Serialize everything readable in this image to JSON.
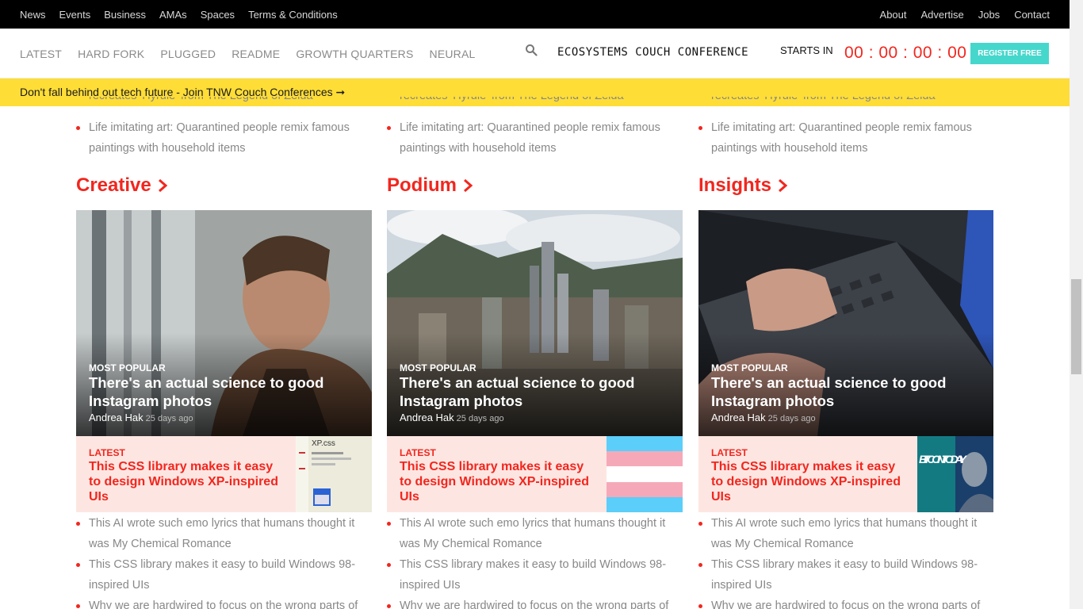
{
  "topnav": {
    "left": [
      "News",
      "Events",
      "Business",
      "AMAs",
      "Spaces",
      "Terms & Conditions"
    ],
    "right": [
      "About",
      "Advertise",
      "Jobs",
      "Contact"
    ]
  },
  "mainnav": {
    "categories": [
      "LATEST",
      "HARD FORK",
      "PLUGGED",
      "README",
      "GROWTH QUARTERS",
      "NEURAL"
    ],
    "conference": "ECOSYSTEMS COUCH CONFERENCE",
    "starts_in": "STARTS IN",
    "timer": "00 : 00 : 00 : 00",
    "register": "REGISTER FREE"
  },
  "banner": {
    "text": "Don't fall behind out tech future - Join TNW Couch Conferences ➞"
  },
  "columns": [
    {
      "top_cut": "recreates 'Hyrule' from The Legend of Zelda",
      "top_bullet": "Life imitating art: Quarantined people remix famous paintings with household items",
      "section": "Creative",
      "hero_kicker": "MOST POPULAR",
      "hero_title": "There's an actual science to good Instagram photos",
      "hero_author": "Andrea Hak",
      "hero_ago": "25 days ago",
      "latest_kicker": "LATEST",
      "latest_title": "This CSS library makes it easy to design Windows XP-inspired UIs",
      "bullets": [
        "This AI wrote such emo lyrics that humans thought it was My Chemical Romance",
        "This CSS library makes it easy to build Windows 98-inspired UIs",
        "Why we are hardwired to focus on the wrong parts of"
      ]
    },
    {
      "top_cut": "recreates 'Hyrule' from The Legend of Zelda",
      "top_bullet": "Life imitating art: Quarantined people remix famous paintings with household items",
      "section": "Podium",
      "hero_kicker": "MOST POPULAR",
      "hero_title": "There's an actual science to good Instagram photos",
      "hero_author": "Andrea Hak",
      "hero_ago": "25 days ago",
      "latest_kicker": "LATEST",
      "latest_title": "This CSS library makes it easy to design Windows XP-inspired UIs",
      "bullets": [
        "This AI wrote such emo lyrics that humans thought it was My Chemical Romance",
        "This CSS library makes it easy to build Windows 98-inspired UIs",
        "Why we are hardwired to focus on the wrong parts of"
      ]
    },
    {
      "top_cut": "recreates 'Hyrule' from The Legend of Zelda",
      "top_bullet": "Life imitating art: Quarantined people remix famous paintings with household items",
      "section": "Insights",
      "hero_kicker": "MOST POPULAR",
      "hero_title": "There's an actual science to good Instagram photos",
      "hero_author": "Andrea Hak",
      "hero_ago": "25 days ago",
      "latest_kicker": "LATEST",
      "latest_title": "This CSS library makes it easy to design Windows XP-inspired UIs",
      "bullets": [
        "This AI wrote such emo lyrics that humans thought it was My Chemical Romance",
        "This CSS library makes it easy to build Windows 98-inspired UIs",
        "Why we are hardwired to focus on the wrong parts of"
      ]
    }
  ],
  "thumb_text": {
    "xp": "XP.css",
    "bitcoin": "BITCOIN TODAY"
  },
  "colors": {
    "accent": "#f2261e",
    "banner": "#fedd36",
    "register": "#46d7cc",
    "latest_bg": "#fde6e2"
  }
}
